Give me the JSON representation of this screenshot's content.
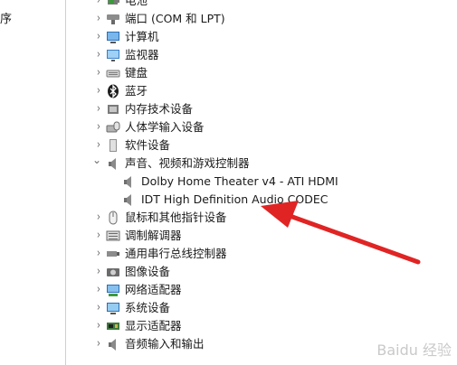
{
  "left_pane": {
    "fragment": "序"
  },
  "tree": [
    {
      "label": "电池",
      "icon": "battery-icon",
      "state": "collapsed"
    },
    {
      "label": "端口 (COM 和 LPT)",
      "icon": "port-icon",
      "state": "collapsed"
    },
    {
      "label": "计算机",
      "icon": "computer-icon",
      "state": "collapsed"
    },
    {
      "label": "监视器",
      "icon": "monitor-icon",
      "state": "collapsed"
    },
    {
      "label": "键盘",
      "icon": "keyboard-icon",
      "state": "collapsed"
    },
    {
      "label": "蓝牙",
      "icon": "bluetooth-icon",
      "state": "collapsed"
    },
    {
      "label": "内存技术设备",
      "icon": "memory-icon",
      "state": "collapsed"
    },
    {
      "label": "人体学输入设备",
      "icon": "hid-icon",
      "state": "collapsed"
    },
    {
      "label": "软件设备",
      "icon": "software-device-icon",
      "state": "collapsed"
    },
    {
      "label": "声音、视频和游戏控制器",
      "icon": "speaker-icon",
      "state": "expanded"
    },
    {
      "label": "Dolby Home Theater v4 - ATI HDMI",
      "icon": "speaker-icon",
      "state": "child"
    },
    {
      "label": "IDT High Definition Audio CODEC",
      "icon": "speaker-icon",
      "state": "child"
    },
    {
      "label": "鼠标和其他指针设备",
      "icon": "mouse-icon",
      "state": "collapsed"
    },
    {
      "label": "调制解调器",
      "icon": "modem-icon",
      "state": "collapsed"
    },
    {
      "label": "通用串行总线控制器",
      "icon": "usb-icon",
      "state": "collapsed"
    },
    {
      "label": "图像设备",
      "icon": "camera-icon",
      "state": "collapsed"
    },
    {
      "label": "网络适配器",
      "icon": "network-icon",
      "state": "collapsed"
    },
    {
      "label": "系统设备",
      "icon": "system-icon",
      "state": "collapsed"
    },
    {
      "label": "显示适配器",
      "icon": "display-adapter-icon",
      "state": "collapsed"
    },
    {
      "label": "音频输入和输出",
      "icon": "speaker-icon",
      "state": "collapsed"
    }
  ],
  "annotation": {
    "color": "#e02424"
  },
  "watermark": "Baidu 经验"
}
